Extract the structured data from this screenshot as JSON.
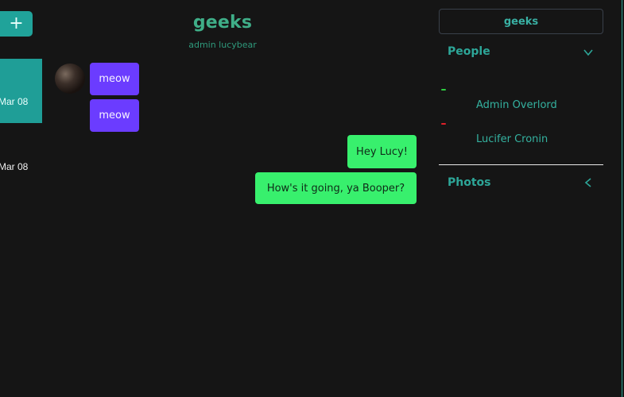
{
  "header": {
    "add_label": "+",
    "room_title": "geeks",
    "room_members": "admin lucybear"
  },
  "dates": {
    "first": "Mar 08",
    "second": "Mar 08"
  },
  "messages": [
    {
      "text": "meow",
      "side": "left",
      "color": "#6b3cff"
    },
    {
      "text": "meow",
      "side": "left",
      "color": "#6b3cff"
    },
    {
      "text": "Hey Lucy!",
      "side": "right",
      "color": "#38f06d"
    },
    {
      "text": "How's it going, ya Booper?",
      "side": "right",
      "color": "#38f06d"
    }
  ],
  "sidebar": {
    "search_value": "geeks",
    "people_label": "People",
    "people": [
      {
        "name": "Admin Overlord",
        "status_color": "#2ecc40"
      },
      {
        "name": "Lucifer Cronin",
        "status_color": "#e0202a"
      }
    ],
    "photos_label": "Photos"
  },
  "colors": {
    "accent": "#20a39a",
    "background": "#151515",
    "outgoing": "#38f06d",
    "incoming": "#6b3cff"
  },
  "icons": {
    "people_toggle": "chevron-down-icon",
    "photos_toggle": "chevron-left-icon",
    "add": "plus-icon"
  }
}
